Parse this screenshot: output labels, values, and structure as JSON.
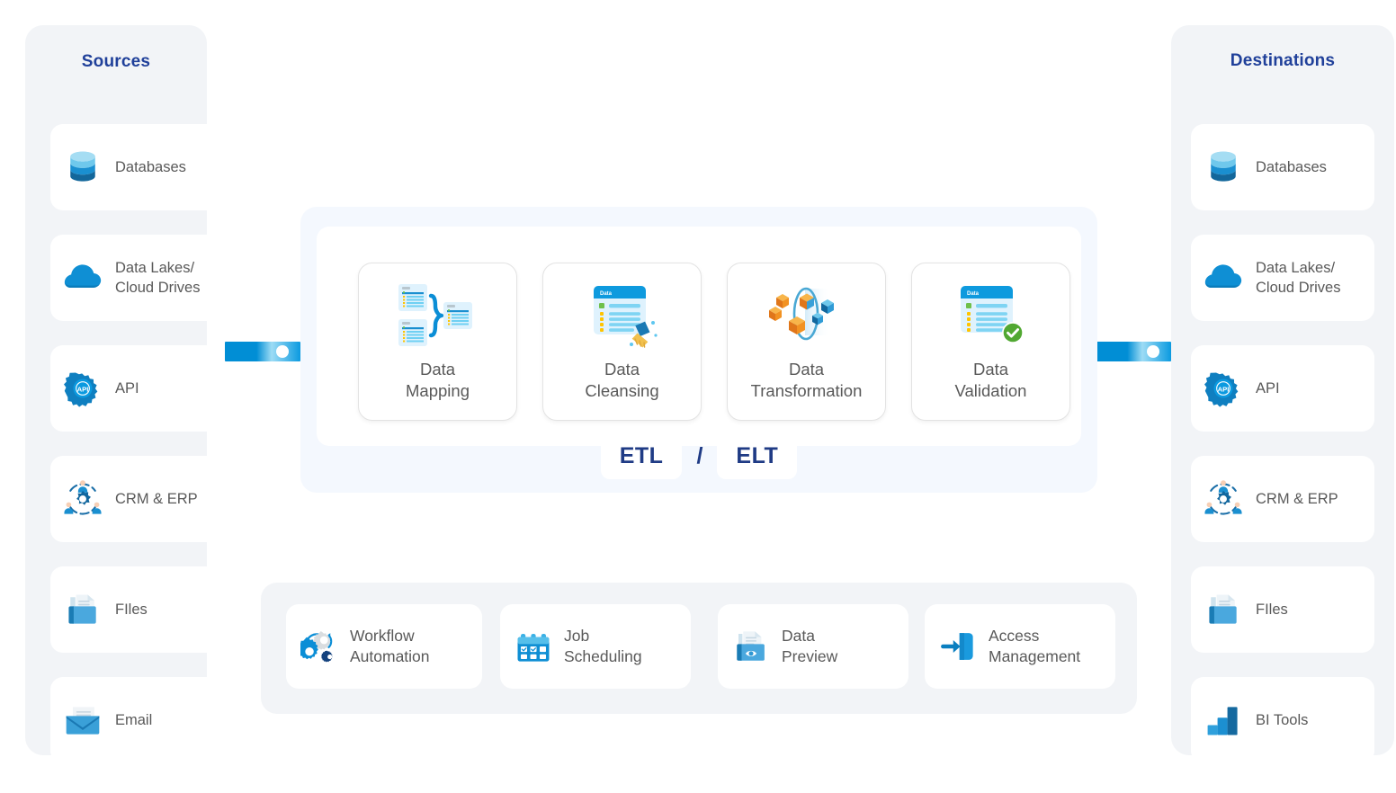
{
  "sources": {
    "title": "Sources",
    "items": [
      {
        "label": "Databases",
        "icon": "database-icon"
      },
      {
        "label": "Data Lakes/\nCloud Drives",
        "icon": "cloud-icon"
      },
      {
        "label": "API",
        "icon": "api-gear-icon"
      },
      {
        "label": "CRM & ERP",
        "icon": "crm-erp-icon"
      },
      {
        "label": "FIles",
        "icon": "files-icon"
      },
      {
        "label": "Email",
        "icon": "email-icon"
      }
    ]
  },
  "destinations": {
    "title": "Destinations",
    "items": [
      {
        "label": "Databases",
        "icon": "database-icon"
      },
      {
        "label": "Data Lakes/\nCloud Drives",
        "icon": "cloud-icon"
      },
      {
        "label": "API",
        "icon": "api-gear-icon"
      },
      {
        "label": "CRM & ERP",
        "icon": "crm-erp-icon"
      },
      {
        "label": "FIles",
        "icon": "files-icon"
      },
      {
        "label": "BI Tools",
        "icon": "bi-tools-icon"
      }
    ]
  },
  "pipeline": {
    "stages": [
      {
        "label": "Data\nMapping",
        "icon": "data-mapping-icon"
      },
      {
        "label": "Data\nCleansing",
        "icon": "data-cleansing-icon"
      },
      {
        "label": "Data\nTransformation",
        "icon": "data-transformation-icon"
      },
      {
        "label": "Data\nValidation",
        "icon": "data-validation-icon"
      }
    ],
    "badges": {
      "left": "ETL",
      "separator": "/",
      "right": "ELT"
    }
  },
  "features": [
    {
      "label": "Workflow\nAutomation",
      "icon": "workflow-gears-icon"
    },
    {
      "label": "Job\nScheduling",
      "icon": "calendar-icon"
    },
    {
      "label": "Data\nPreview",
      "icon": "document-eye-icon"
    },
    {
      "label": "Access\nManagement",
      "icon": "access-login-icon"
    }
  ],
  "connectors": [
    {
      "name": "source-to-pipeline-connector"
    },
    {
      "name": "pipeline-to-destination-connector"
    }
  ],
  "colors": {
    "heading_navy": "#20409a",
    "badge_navy": "#1f3b85",
    "accent_blue": "#018ed5",
    "panel_gray": "#f2f4f7",
    "pipeline_bg": "#f4f8fe",
    "label_gray": "#595959",
    "check_green": "#51a832",
    "cube_orange": "#f29222"
  }
}
